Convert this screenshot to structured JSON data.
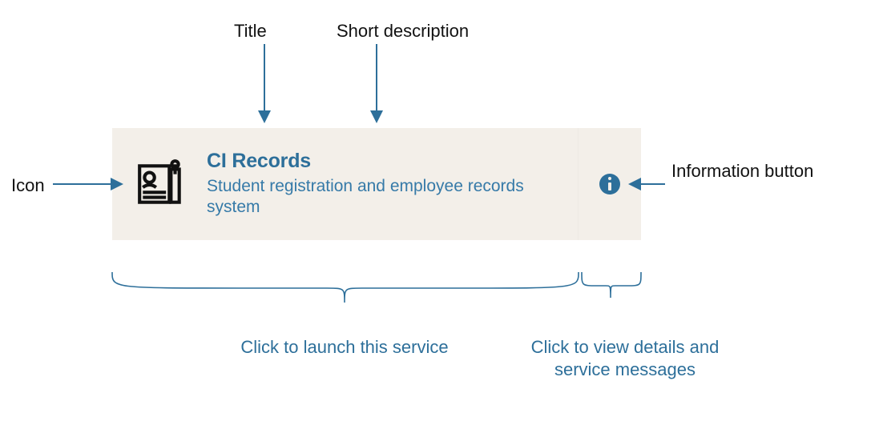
{
  "labels": {
    "title": "Title",
    "short_desc": "Short description",
    "icon": "Icon",
    "info_button": "Information button"
  },
  "card": {
    "title": "CI Records",
    "description": "Student registration and employee records system"
  },
  "captions": {
    "launch": "Click to launch this service",
    "details": "Click to view details and service messages"
  }
}
